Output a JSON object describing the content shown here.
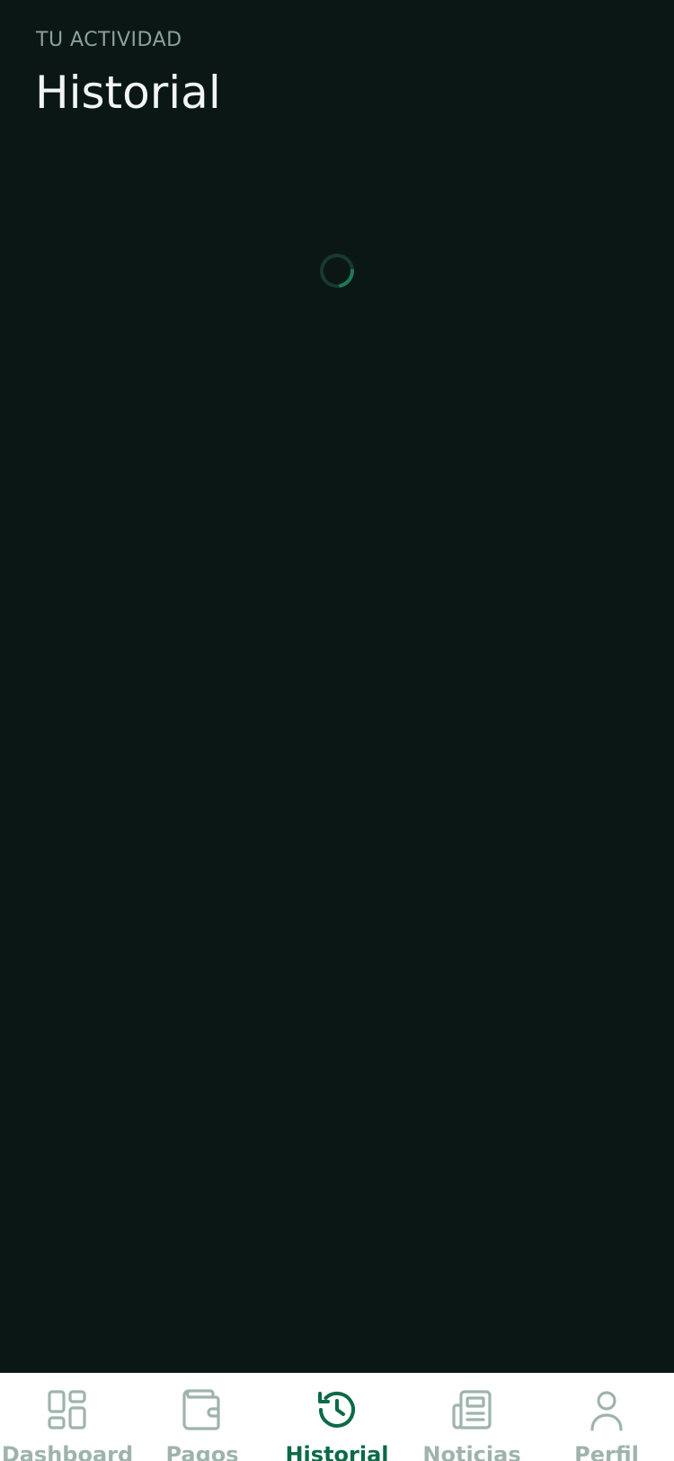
{
  "header": {
    "eyebrow": "TU ACTIVIDAD",
    "title": "Historial"
  },
  "loading": {
    "indicator": "spinner"
  },
  "bottom_nav": {
    "active": "Historial",
    "items": [
      {
        "label": "Dashboard",
        "icon": "dashboard-grid-icon"
      },
      {
        "label": "Pagos",
        "icon": "wallet-icon"
      },
      {
        "label": "Historial",
        "icon": "history-clock-icon"
      },
      {
        "label": "Noticias",
        "icon": "newspaper-icon"
      },
      {
        "label": "Perfil",
        "icon": "user-icon"
      }
    ]
  },
  "colors": {
    "background": "#0b1715",
    "accent": "#0c6a46",
    "inactive": "#9fb3ad",
    "nav_background": "#ffffff"
  }
}
